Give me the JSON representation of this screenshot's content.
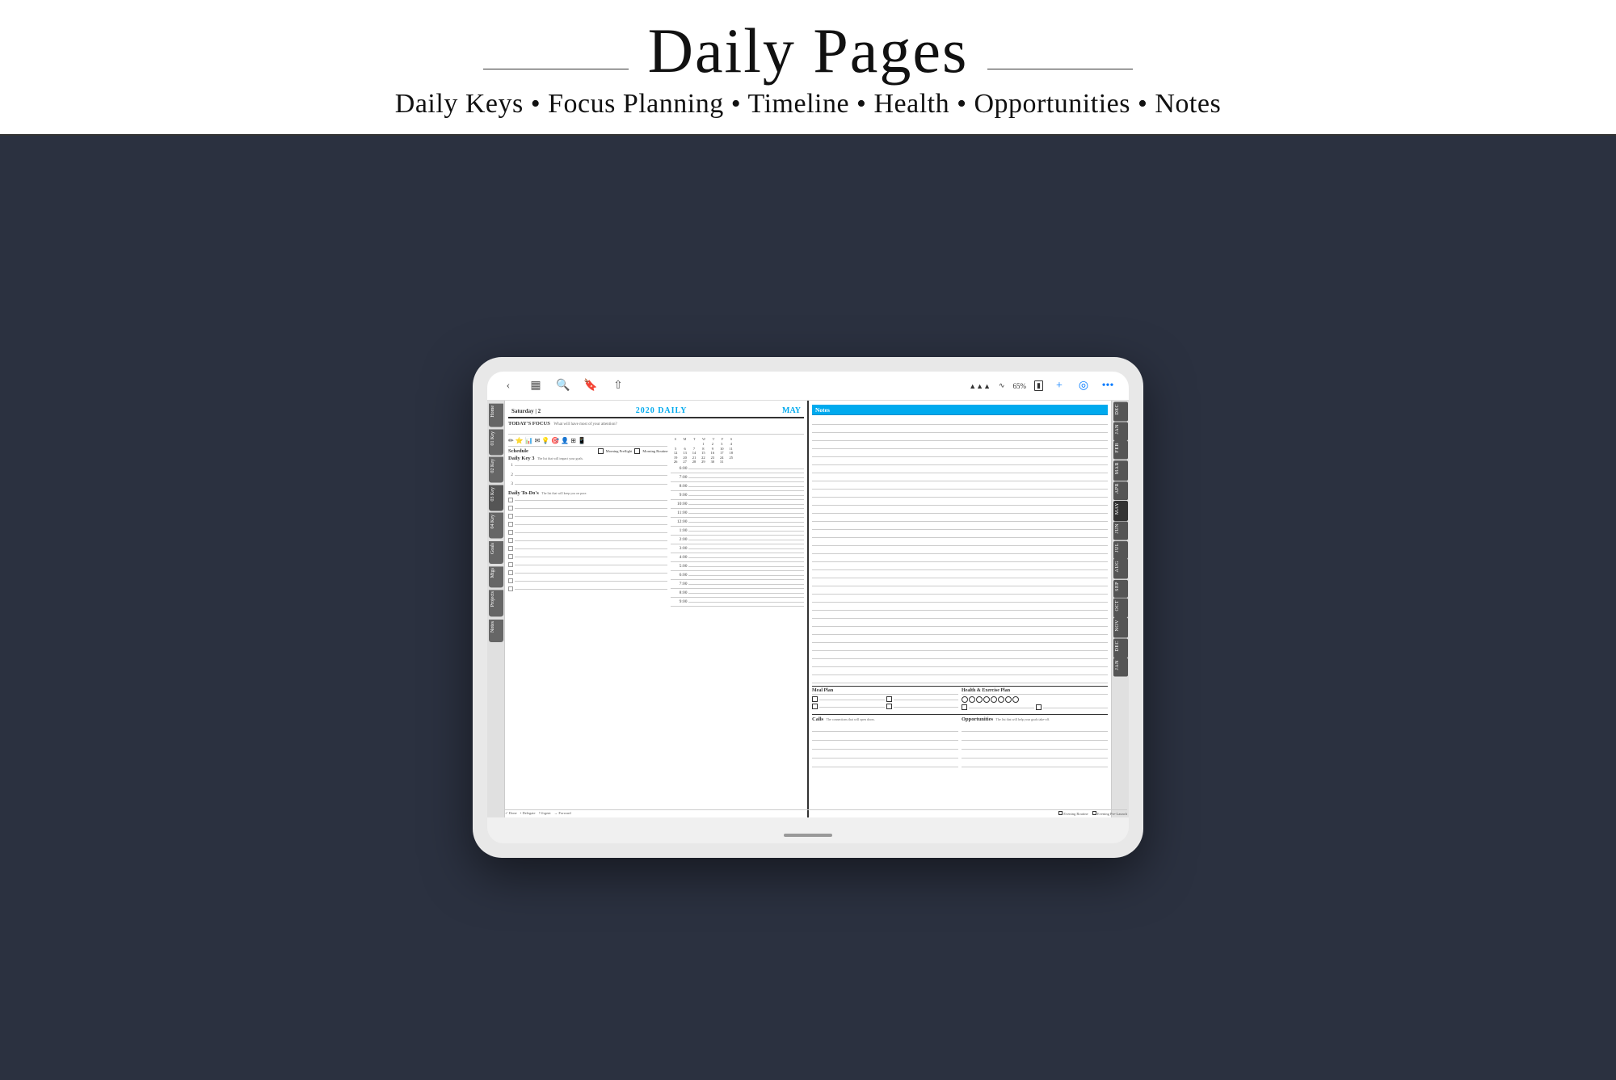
{
  "header": {
    "title": "Daily Pages",
    "subtitle": "Daily Keys • Focus Planning • Timeline • Health • Opportunities • Notes"
  },
  "tablet": {
    "status": {
      "signal": "▲▲▲",
      "wifi": "wifi",
      "battery": "65%"
    },
    "toolbar_left": [
      "←",
      "⊞",
      "🔍",
      "🔖",
      "⬆"
    ],
    "toolbar_right": [
      "+",
      "◎",
      "•••"
    ]
  },
  "left_sidebar": {
    "tabs": [
      "Home",
      "01 Key",
      "02 Key",
      "03 Key",
      "04 Key",
      "Goals",
      "Mtgs",
      "Projects",
      "Notes"
    ]
  },
  "right_sidebar": {
    "months": [
      "DEC",
      "JAN",
      "FEB",
      "MAR",
      "APR",
      "MAY",
      "JUN",
      "JUL",
      "AUG",
      "SEP",
      "OCT",
      "NOV",
      "DEC",
      "JAN"
    ]
  },
  "left_page": {
    "date": "Saturday | 2",
    "year_daily": "2020 DAILY",
    "month": "MAY",
    "focus_label": "TODAY'S FOCUS",
    "focus_sublabel": "What will have most of your attention?",
    "schedule_label": "Schedule",
    "morning_preflight": "Morning Preflight",
    "morning_routine": "Morning Routine",
    "daily_key_label": "Daily Key 3",
    "daily_key_sublabel": "The list that will impact your goals.",
    "key_items": [
      "1",
      "2",
      "3"
    ],
    "daily_todo_label": "Daily To-Do's",
    "daily_todo_sublabel": "The list that will keep you on pace.",
    "times": [
      "6:00",
      "7:00",
      "8:00",
      "9:00",
      "10:00",
      "11:00",
      "12:00",
      "1:00",
      "2:00",
      "3:00",
      "4:00",
      "5:00",
      "6:00",
      "7:00",
      "8:00",
      "9:00"
    ],
    "footer_items": [
      "✓ Done",
      "• Delegate",
      "! Urgent",
      "→ Forward"
    ],
    "footer_right": [
      "Evening Routine",
      "Evening Pre-Launch"
    ]
  },
  "right_page": {
    "notes_label": "Notes",
    "meal_plan_label": "Meal Plan",
    "health_label": "Health & Exercise Plan",
    "calls_label": "Calls",
    "calls_sublabel": "The connections that will open doors.",
    "opportunities_label": "Opportunities",
    "opportunities_sublabel": "The list that will help your goals take-off."
  },
  "calendar": {
    "days": [
      "S",
      "M",
      "T",
      "W",
      "T",
      "F",
      "S"
    ],
    "weeks": [
      [
        "",
        "",
        "",
        "1",
        "2",
        "3",
        "4"
      ],
      [
        "5",
        "6",
        "7",
        "8",
        "9",
        "10",
        "11"
      ],
      [
        "12",
        "13",
        "14",
        "15",
        "16",
        "17",
        "18"
      ],
      [
        "19",
        "20",
        "21",
        "22",
        "23",
        "24",
        "25"
      ],
      [
        "26",
        "27",
        "28",
        "29",
        "30",
        "31",
        ""
      ]
    ]
  }
}
